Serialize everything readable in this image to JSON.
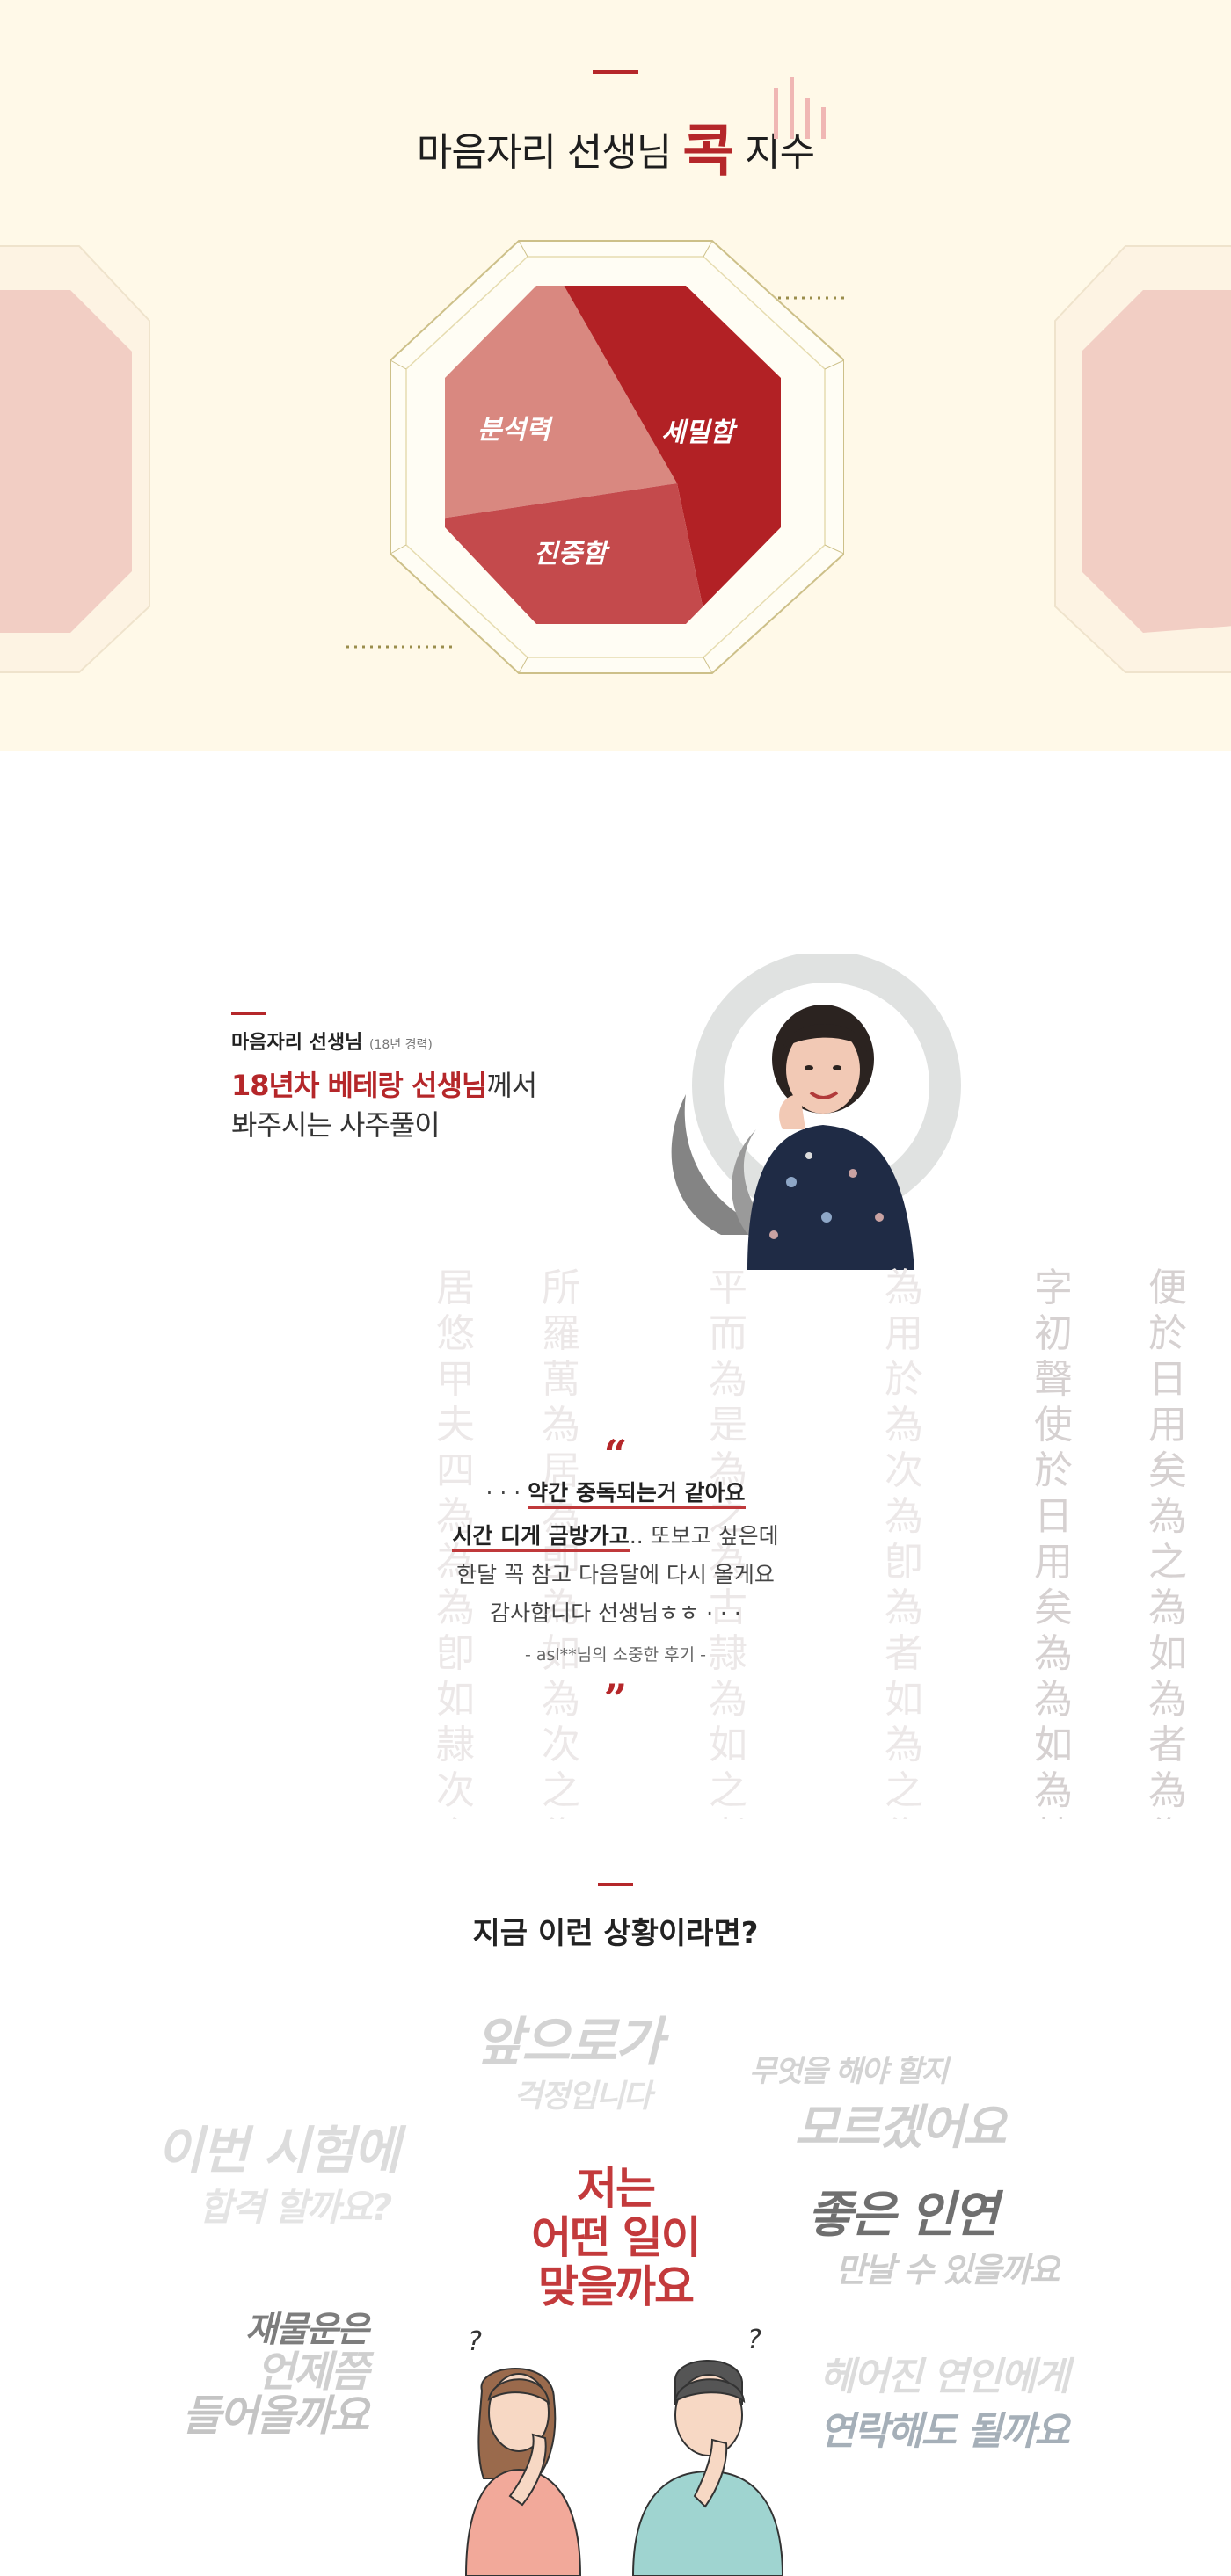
{
  "score_section": {
    "title_pre": "마음자리 선생님",
    "title_highlight": "콕",
    "title_post": "지수",
    "labels": {
      "analysis": "분석력",
      "detail": "세밀함",
      "care": "진중함"
    },
    "share": {
      "analysis": 0.25,
      "detail": 0.5,
      "care": 0.25
    },
    "colors": {
      "analysis": "#d98880",
      "detail": "#b22125",
      "care": "#c44a4c",
      "accent": "#b5272a"
    }
  },
  "teacher": {
    "name": "마음자리 선생님",
    "experience": "(18년 경력)",
    "headline_highlight": "18년차 베테랑 선생님",
    "headline_rest": "께서",
    "headline_line2": "봐주시는 사주풀이"
  },
  "review": {
    "line1_prefix": "· · ·",
    "line1_emph": "약간 중독되는거 같아요",
    "line2_emph": "시간 디게 금방가고",
    "line2_rest": ".. 또보고 싶은데",
    "line3": "한달 꼭 참고 다음달에 다시 올게요",
    "line4": "감사합니다 선생님ㅎㅎ · · ·",
    "author": "- asl**님의 소중한 후기 -",
    "open_quote": "“",
    "close_quote": "”"
  },
  "situations": {
    "title": "지금 이런 상황이라면?",
    "center": [
      "저는",
      "어떤 일이",
      "맞을까요"
    ],
    "q1": [
      "앞으로가",
      "걱정입니다"
    ],
    "q2": [
      "무엇을 해야 할지",
      "모르겠어요"
    ],
    "q3": [
      "이번 시험에",
      "합격 할까요?"
    ],
    "q4": [
      "좋은 인연",
      "만날 수 있을까요"
    ],
    "q5": [
      "재물운은",
      "언제쯤",
      "들어올까요"
    ],
    "q6": [
      "헤어진 연인에게",
      "연락해도 될까요"
    ],
    "thinking_marks": [
      "?",
      "?"
    ]
  },
  "hanja_columns": [
    "居悠甲夫四為為為卽如隷次之為者如為為",
    "所羅萬為居為卽為如為次之為者使如為",
    "平而為是為之為古隷為如之者為而",
    "為用於為次為卽為者如為之為使為",
    "字初聲使於日用矣為為如為隷",
    "便於日用矣為之為如為者為為"
  ]
}
